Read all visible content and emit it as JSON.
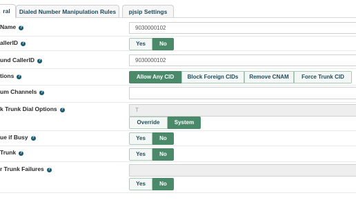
{
  "tabs": [
    {
      "label": "ral",
      "active": true
    },
    {
      "label": "Dialed Number Manipulation Rules",
      "active": false
    },
    {
      "label": "pjsip Settings",
      "active": false
    }
  ],
  "fields": {
    "name": {
      "label": "Name",
      "value": "9030000102"
    },
    "callerid": {
      "label": "allerID",
      "yes": "Yes",
      "no": "No",
      "selected": "No"
    },
    "outbound_callerid": {
      "label": "und CallerID",
      "value": "9030000102"
    },
    "cid_options": {
      "label": "tions",
      "options": [
        "Allow Any CID",
        "Block Foreign CIDs",
        "Remove CNAM",
        "Force Trunk CID"
      ],
      "selected": "Allow Any CID"
    },
    "max_channels": {
      "label": "um Channels",
      "value": ""
    },
    "dial_options": {
      "label": "k Trunk Dial Options",
      "placeholder": "T",
      "options": [
        "Override",
        "System"
      ],
      "selected": "System"
    },
    "continue_if_busy": {
      "label": "ue if Busy",
      "yes": "Yes",
      "no": "No",
      "selected": "No"
    },
    "disable_trunk": {
      "label": "Trunk",
      "yes": "Yes",
      "no": "No",
      "selected": "No"
    },
    "monitor_failures": {
      "label": "r Trunk Failures",
      "value": "",
      "yes": "Yes",
      "no": "No",
      "selected": "No"
    }
  },
  "help_icon_glyph": "?"
}
